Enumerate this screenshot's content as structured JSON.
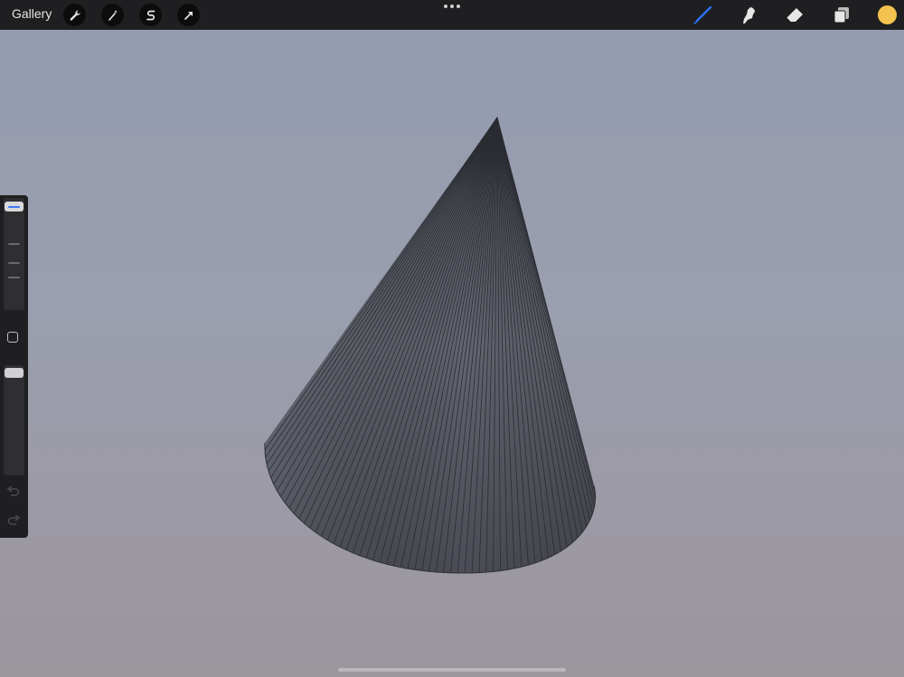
{
  "topbar": {
    "gallery_label": "Gallery",
    "left_tools": [
      "wrench-icon",
      "magic-wand-icon",
      "selection-s-icon",
      "transform-arrow-icon"
    ],
    "right_tools": [
      "brush-icon",
      "smudge-icon",
      "eraser-icon",
      "layers-icon"
    ],
    "active_tool": "brush-icon",
    "active_tool_color": "#2f6ff5",
    "current_color": "#f4c24f"
  },
  "sidebar": {
    "brush_size_level": 0.97,
    "opacity_level": 1.0,
    "controls": [
      "brush-size-slider",
      "modify-button",
      "opacity-slider",
      "undo-button",
      "redo-button"
    ]
  },
  "canvas": {
    "object": "cone",
    "background_top": "#949bb0",
    "background_bottom": "#9b959c"
  }
}
